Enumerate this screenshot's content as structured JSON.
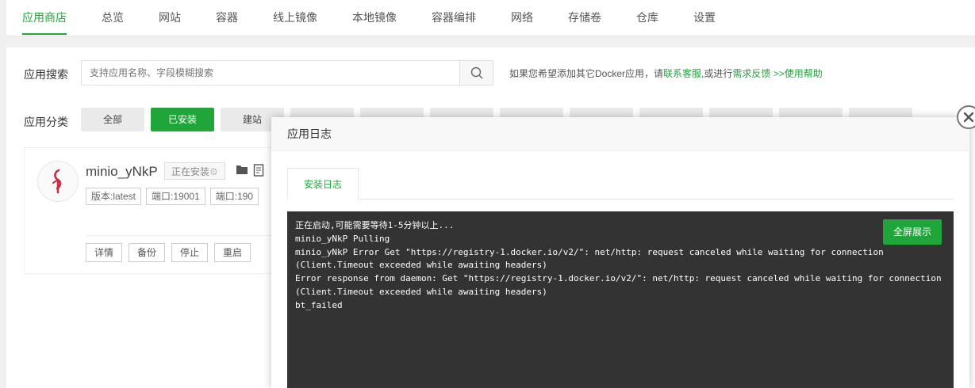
{
  "colors": {
    "accent": "#20a53a",
    "log_bg": "#333333",
    "log_text": "#ffffff"
  },
  "topnav": {
    "tabs": [
      {
        "label": "应用商店",
        "active": true
      },
      {
        "label": "总览"
      },
      {
        "label": "网站"
      },
      {
        "label": "容器"
      },
      {
        "label": "线上镜像"
      },
      {
        "label": "本地镜像"
      },
      {
        "label": "容器编排"
      },
      {
        "label": "网络"
      },
      {
        "label": "存储卷"
      },
      {
        "label": "仓库"
      },
      {
        "label": "设置"
      }
    ]
  },
  "search": {
    "label": "应用搜索",
    "placeholder": "支持应用名称、字段模糊搜索",
    "icon": "search-icon",
    "tip_prefix": "如果您希望添加其它Docker应用，请",
    "tip_link1": "联系客服",
    "tip_mid": ",或进行",
    "tip_link2": "需求反馈",
    "tip_link3": " >>使用帮助"
  },
  "categories": {
    "label": "应用分类",
    "items": [
      {
        "label": "全部"
      },
      {
        "label": "已安装",
        "active": true
      },
      {
        "label": "建站"
      }
    ]
  },
  "app_card": {
    "name": "minio_yNkP",
    "status": "正在安装",
    "tags": [
      "版本:latest",
      "端口:19001",
      "端口:190"
    ],
    "actions": [
      "详情",
      "备份",
      "停止",
      "重启"
    ]
  },
  "modal": {
    "title": "应用日志",
    "tab": "安装日志",
    "fullscreen_label": "全屏展示",
    "log_lines": [
      "正在启动,可能需要等待1-5分钟以上...",
      "minio_yNkP Pulling",
      "minio_yNkP Error Get \"https://registry-1.docker.io/v2/\": net/http: request canceled while waiting for connection",
      "(Client.Timeout exceeded while awaiting headers)",
      "Error response from daemon: Get \"https://registry-1.docker.io/v2/\": net/http: request canceled while waiting for connection",
      "(Client.Timeout exceeded while awaiting headers)",
      "bt_failed"
    ]
  }
}
